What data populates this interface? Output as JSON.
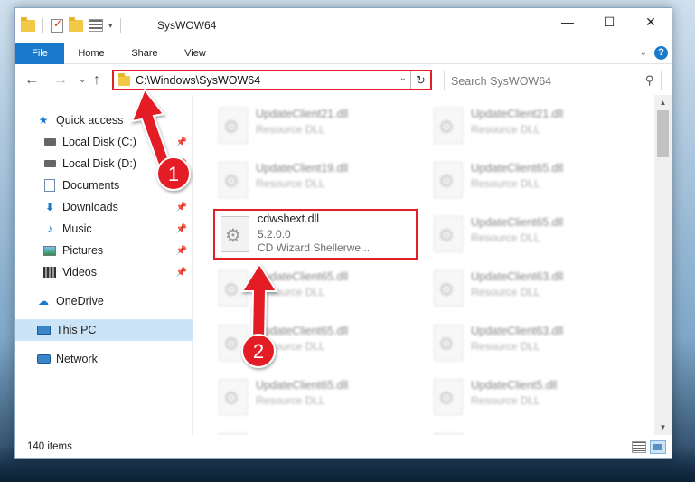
{
  "window": {
    "title": "SysWOW64",
    "controls": {
      "minimize": "—",
      "maximize": "☐",
      "close": "✕"
    }
  },
  "ribbon": {
    "tabs": [
      "File",
      "Home",
      "Share",
      "View"
    ],
    "help": "?"
  },
  "nav": {
    "address": "C:\\Windows\\SysWOW64",
    "search_placeholder": "Search SysWOW64"
  },
  "sidebar": {
    "items": [
      {
        "label": "Quick access",
        "icon": "star-icon",
        "pinned": false
      },
      {
        "label": "Local Disk (C:)",
        "icon": "drive-icon",
        "pinned": true
      },
      {
        "label": "Local Disk (D:)",
        "icon": "drive-icon",
        "pinned": true
      },
      {
        "label": "Documents",
        "icon": "documents-icon",
        "pinned": true
      },
      {
        "label": "Downloads",
        "icon": "downloads-icon",
        "pinned": true
      },
      {
        "label": "Music",
        "icon": "music-icon",
        "pinned": true
      },
      {
        "label": "Pictures",
        "icon": "pictures-icon",
        "pinned": true
      },
      {
        "label": "Videos",
        "icon": "videos-icon",
        "pinned": true
      },
      {
        "label": "OneDrive",
        "icon": "onedrive-icon",
        "pinned": false
      },
      {
        "label": "This PC",
        "icon": "this-pc-icon",
        "pinned": false,
        "selected": true
      },
      {
        "label": "Network",
        "icon": "network-icon",
        "pinned": false
      }
    ]
  },
  "files": {
    "column_left": [
      {
        "name": "UpdateClient21.dll",
        "type": "Resource DLL",
        "blurred": true
      },
      {
        "name": "UpdateClient19.dll",
        "type": "Resource DLL",
        "blurred": true
      },
      {
        "name": "cdwshext.dll",
        "type": "5.2.0.0",
        "description": "CD Wizard Shellerwe...",
        "blurred": false,
        "highlighted": true
      },
      {
        "name": "UpdateClient65.dll",
        "type": "Resource DLL",
        "blurred": true
      },
      {
        "name": "UpdateClient65.dll",
        "type": "Resource DLL",
        "blurred": true
      },
      {
        "name": "UpdateClient65.dll",
        "type": "Resource DLL",
        "blurred": true
      },
      {
        "name": "",
        "type": "",
        "blurred": true
      }
    ],
    "column_right": [
      {
        "name": "UpdateClient21.dll",
        "type": "Resource DLL",
        "blurred": true
      },
      {
        "name": "UpdateClient65.dll",
        "type": "Resource DLL",
        "blurred": true
      },
      {
        "name": "UpdateClient65.dll",
        "type": "Resource DLL",
        "blurred": true
      },
      {
        "name": "UpdateClient63.dll",
        "type": "Resource DLL",
        "blurred": true
      },
      {
        "name": "UpdateClient63.dll",
        "type": "Resource DLL",
        "blurred": true
      },
      {
        "name": "UpdateClient5.dll",
        "type": "Resource DLL",
        "blurred": true
      },
      {
        "name": "",
        "type": "",
        "blurred": true
      }
    ]
  },
  "status": {
    "items_count": "140 items"
  },
  "annotations": {
    "step1": "1",
    "step2": "2",
    "accent": "#e31f25"
  }
}
